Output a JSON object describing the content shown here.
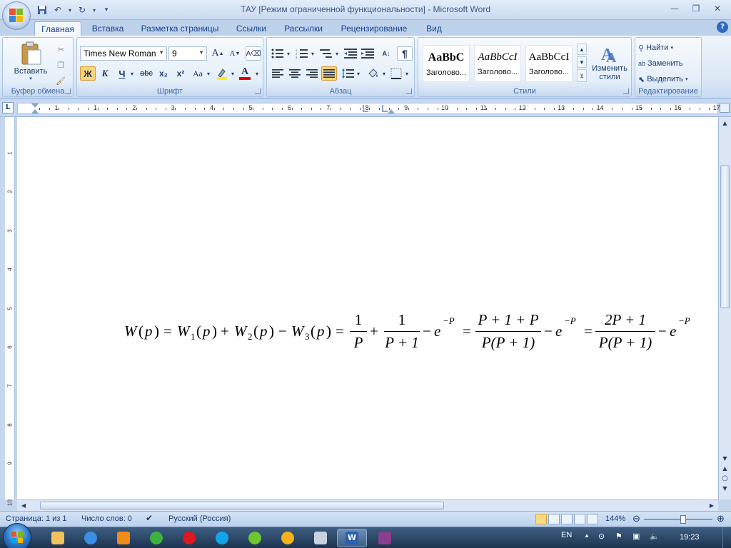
{
  "window": {
    "title": "ТАУ [Режим ограниченной функциональности] - Microsoft Word"
  },
  "tabs": [
    "Главная",
    "Вставка",
    "Разметка страницы",
    "Ссылки",
    "Рассылки",
    "Рецензирование",
    "Вид"
  ],
  "ribbon": {
    "clipboard": {
      "label": "Буфер обмена",
      "paste_label": "Вставить"
    },
    "font": {
      "label": "Шрифт",
      "font_name": "Times New Roman",
      "font_size": "9",
      "bold": "Ж",
      "italic": "К",
      "underline": "Ч",
      "strike": "abc",
      "subscript": "x₂",
      "superscript": "x²",
      "case": "Aa",
      "grow": "A",
      "shrink": "A",
      "font_color": "A"
    },
    "paragraph": {
      "label": "Абзац",
      "pilcrow": "¶"
    },
    "styles": {
      "label": "Стили",
      "items": [
        {
          "sample": "AaBbC",
          "name": "Заголово..."
        },
        {
          "sample": "AaBbCcI",
          "name": "Заголово..."
        },
        {
          "sample": "AaBbCcI",
          "name": "Заголово..."
        }
      ],
      "change_styles_line1": "Изменить",
      "change_styles_line2": "стили"
    },
    "editing": {
      "label": "Редактирование",
      "find": "Найти",
      "replace": "Заменить",
      "select": "Выделить"
    }
  },
  "ruler": {
    "corner": "L",
    "numbers": [
      "1",
      "1",
      "2",
      "3",
      "4",
      "5",
      "6",
      "7",
      "8",
      "9",
      "10",
      "11",
      "12",
      "13",
      "14",
      "15",
      "16",
      "17"
    ],
    "vnumbers": [
      "1",
      "2",
      "3",
      "4",
      "5",
      "6",
      "7",
      "8",
      "9",
      "10"
    ]
  },
  "document": {
    "formula": {
      "W": "W",
      "p": "p",
      "eq": "=",
      "plus": "+",
      "minus": "−",
      "one": "1",
      "P": "P",
      "P_plus_1": "P + 1",
      "e": "e",
      "neg_P": "−P",
      "num3": "P + 1 + P",
      "den3": "P(P + 1)",
      "num4": "2P + 1",
      "den4": "P(P + 1)",
      "sub1": "1",
      "sub2": "2",
      "sub3": "3",
      "lp": "(",
      "rp": ")"
    }
  },
  "status": {
    "page": "Страница: 1 из 1",
    "words": "Число слов: 0",
    "language": "Русский (Россия)",
    "zoom": "144%",
    "zoom_fraction": 0.45
  },
  "taskbar": {
    "lang": "EN",
    "time": "19:23"
  },
  "colors": {
    "ribbon_bg": "#dce8f6",
    "tab_active": "#f3f7fc",
    "text_blue": "#15428b",
    "taskbar": "#1d3450"
  }
}
